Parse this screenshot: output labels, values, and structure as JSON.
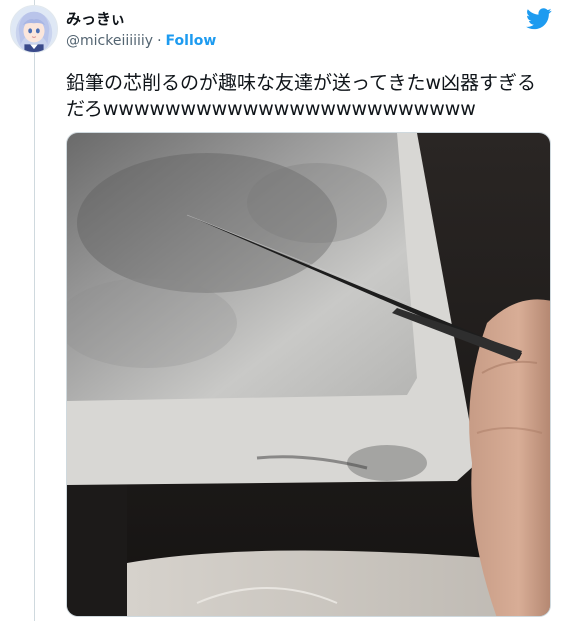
{
  "tweet": {
    "display_name": "みっきぃ",
    "handle": "@mickeiiiiiiy",
    "separator": "·",
    "follow_label": "Follow",
    "text": "鉛筆の芯削るのが趣味な友達が送ってきたw凶器すぎるだろwwwwwwwwwwwwwwwwwwwwwwww"
  },
  "icons": {
    "brand": "twitter-bird-icon",
    "brand_color": "#1d9bf0"
  },
  "media": {
    "kind": "photo",
    "subject": "sharpened-pencil-lead-on-paper"
  }
}
